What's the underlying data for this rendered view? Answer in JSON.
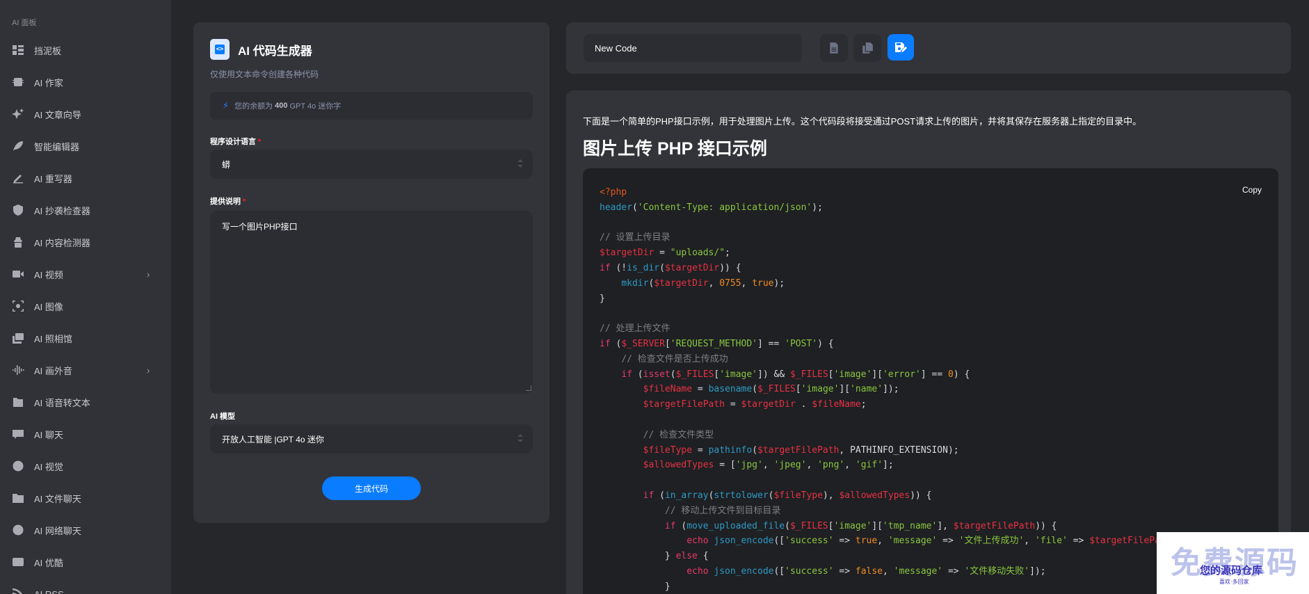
{
  "sidebar": {
    "section_label": "AI 面板",
    "items": [
      {
        "label": "挡泥板",
        "icon": "dashboard-icon",
        "has_submenu": false
      },
      {
        "label": "AI 作家",
        "icon": "ai-chip-icon",
        "has_submenu": false
      },
      {
        "label": "AI 文章向导",
        "icon": "sparkles-icon",
        "has_submenu": false
      },
      {
        "label": "智能编辑器",
        "icon": "feather-icon",
        "has_submenu": false
      },
      {
        "label": "AI 重写器",
        "icon": "pen-icon",
        "has_submenu": false
      },
      {
        "label": "AI 抄袭检查器",
        "icon": "shield-check-icon",
        "has_submenu": false
      },
      {
        "label": "AI 内容检测器",
        "icon": "detective-icon",
        "has_submenu": false
      },
      {
        "label": "AI 视频",
        "icon": "video-camera-icon",
        "has_submenu": true
      },
      {
        "label": "AI 图像",
        "icon": "image-scan-icon",
        "has_submenu": false
      },
      {
        "label": "AI 照相馆",
        "icon": "photo-gallery-icon",
        "has_submenu": false
      },
      {
        "label": "AI 画外音",
        "icon": "waveform-icon",
        "has_submenu": true
      },
      {
        "label": "AI 语音转文本",
        "icon": "audio-file-icon",
        "has_submenu": false
      },
      {
        "label": "AI 聊天",
        "icon": "chat-bubble-icon",
        "has_submenu": false
      },
      {
        "label": "AI 视觉",
        "icon": "brain-icon",
        "has_submenu": false
      },
      {
        "label": "AI 文件聊天",
        "icon": "folder-dots-icon",
        "has_submenu": false
      },
      {
        "label": "AI 网络聊天",
        "icon": "globe-icon",
        "has_submenu": false
      },
      {
        "label": "AI 优酷",
        "icon": "youtube-icon",
        "has_submenu": false
      },
      {
        "label": "AI RSS",
        "icon": "rss-icon",
        "has_submenu": false
      }
    ],
    "submenu_chevron": "›"
  },
  "generator": {
    "title": "AI 代码生成器",
    "subtitle": "仅使用文本命令创建各种代码",
    "balance_prefix": "您的余额为",
    "balance_amount": "400",
    "balance_suffix": "GPT 4o 迷你字",
    "language_label": "程序设计语言",
    "language_value": "蟒",
    "description_label": "提供说明",
    "description_value": "写一个图片PHP接口",
    "model_label": "AI 模型",
    "model_value": "开放人工智能 |GPT 4o 迷你",
    "required_mark": "*",
    "generate_button": "生成代码"
  },
  "document": {
    "name_value": "New Code",
    "toolbar": [
      "document-icon",
      "copy-icon",
      "save-icon"
    ]
  },
  "result": {
    "intro": "下面是一个简单的PHP接口示例，用于处理图片上传。这个代码段将接受通过POST请求上传的图片，并将其保存在服务器上指定的目录中。",
    "heading": "图片上传 PHP 接口示例",
    "copy_label": "Copy",
    "code_lines": [
      [
        [
          "tag",
          "<?php"
        ]
      ],
      [
        [
          "fn",
          "header"
        ],
        [
          "p",
          "("
        ],
        [
          "str",
          "'Content-Type: application/json'"
        ],
        [
          "p",
          ");"
        ]
      ],
      [],
      [
        [
          "com",
          "// 设置上传目录"
        ]
      ],
      [
        [
          "var",
          "$targetDir"
        ],
        [
          "p",
          " = "
        ],
        [
          "str",
          "\"uploads/\""
        ],
        [
          "p",
          ";"
        ]
      ],
      [
        [
          "kw",
          "if"
        ],
        [
          "p",
          " (!"
        ],
        [
          "fn",
          "is_dir"
        ],
        [
          "p",
          "("
        ],
        [
          "var",
          "$targetDir"
        ],
        [
          "p",
          ")) {"
        ]
      ],
      [
        [
          "p",
          "    "
        ],
        [
          "fn",
          "mkdir"
        ],
        [
          "p",
          "("
        ],
        [
          "var",
          "$targetDir"
        ],
        [
          "p",
          ", "
        ],
        [
          "num",
          "0755"
        ],
        [
          "p",
          ", "
        ],
        [
          "num",
          "true"
        ],
        [
          "p",
          ");"
        ]
      ],
      [
        [
          "p",
          "}"
        ]
      ],
      [],
      [
        [
          "com",
          "// 处理上传文件"
        ]
      ],
      [
        [
          "kw",
          "if"
        ],
        [
          "p",
          " ("
        ],
        [
          "var",
          "$_SERVER"
        ],
        [
          "p",
          "["
        ],
        [
          "str",
          "'REQUEST_METHOD'"
        ],
        [
          "p",
          "] == "
        ],
        [
          "str",
          "'POST'"
        ],
        [
          "p",
          ") {"
        ]
      ],
      [
        [
          "p",
          "    "
        ],
        [
          "com",
          "// 检查文件是否上传成功"
        ]
      ],
      [
        [
          "p",
          "    "
        ],
        [
          "kw",
          "if"
        ],
        [
          "p",
          " ("
        ],
        [
          "kw",
          "isset"
        ],
        [
          "p",
          "("
        ],
        [
          "var",
          "$_FILES"
        ],
        [
          "p",
          "["
        ],
        [
          "str",
          "'image'"
        ],
        [
          "p",
          "]) && "
        ],
        [
          "var",
          "$_FILES"
        ],
        [
          "p",
          "["
        ],
        [
          "str",
          "'image'"
        ],
        [
          "p",
          "]["
        ],
        [
          "str",
          "'error'"
        ],
        [
          "p",
          "] == "
        ],
        [
          "num",
          "0"
        ],
        [
          "p",
          ") {"
        ]
      ],
      [
        [
          "p",
          "        "
        ],
        [
          "var",
          "$fileName"
        ],
        [
          "p",
          " = "
        ],
        [
          "fn",
          "basename"
        ],
        [
          "p",
          "("
        ],
        [
          "var",
          "$_FILES"
        ],
        [
          "p",
          "["
        ],
        [
          "str",
          "'image'"
        ],
        [
          "p",
          "]["
        ],
        [
          "str",
          "'name'"
        ],
        [
          "p",
          "]);"
        ]
      ],
      [
        [
          "p",
          "        "
        ],
        [
          "var",
          "$targetFilePath"
        ],
        [
          "p",
          " = "
        ],
        [
          "var",
          "$targetDir"
        ],
        [
          "p",
          " . "
        ],
        [
          "var",
          "$fileName"
        ],
        [
          "p",
          ";"
        ]
      ],
      [],
      [
        [
          "p",
          "        "
        ],
        [
          "com",
          "// 检查文件类型"
        ]
      ],
      [
        [
          "p",
          "        "
        ],
        [
          "var",
          "$fileType"
        ],
        [
          "p",
          " = "
        ],
        [
          "fn",
          "pathinfo"
        ],
        [
          "p",
          "("
        ],
        [
          "var",
          "$targetFilePath"
        ],
        [
          "p",
          ", PATHINFO_EXTENSION);"
        ]
      ],
      [
        [
          "p",
          "        "
        ],
        [
          "var",
          "$allowedTypes"
        ],
        [
          "p",
          " = ["
        ],
        [
          "str",
          "'jpg'"
        ],
        [
          "p",
          ", "
        ],
        [
          "str",
          "'jpeg'"
        ],
        [
          "p",
          ", "
        ],
        [
          "str",
          "'png'"
        ],
        [
          "p",
          ", "
        ],
        [
          "str",
          "'gif'"
        ],
        [
          "p",
          "];"
        ]
      ],
      [],
      [
        [
          "p",
          "        "
        ],
        [
          "kw",
          "if"
        ],
        [
          "p",
          " ("
        ],
        [
          "fn",
          "in_array"
        ],
        [
          "p",
          "("
        ],
        [
          "fn",
          "strtolower"
        ],
        [
          "p",
          "("
        ],
        [
          "var",
          "$fileType"
        ],
        [
          "p",
          "), "
        ],
        [
          "var",
          "$allowedTypes"
        ],
        [
          "p",
          ")) {"
        ]
      ],
      [
        [
          "p",
          "            "
        ],
        [
          "com",
          "// 移动上传文件到目标目录"
        ]
      ],
      [
        [
          "p",
          "            "
        ],
        [
          "kw",
          "if"
        ],
        [
          "p",
          " ("
        ],
        [
          "fn",
          "move_uploaded_file"
        ],
        [
          "p",
          "("
        ],
        [
          "var",
          "$_FILES"
        ],
        [
          "p",
          "["
        ],
        [
          "str",
          "'image'"
        ],
        [
          "p",
          "]["
        ],
        [
          "str",
          "'tmp_name'"
        ],
        [
          "p",
          "], "
        ],
        [
          "var",
          "$targetFilePath"
        ],
        [
          "p",
          ")) {"
        ]
      ],
      [
        [
          "p",
          "                "
        ],
        [
          "kw",
          "echo"
        ],
        [
          "p",
          " "
        ],
        [
          "fn",
          "json_encode"
        ],
        [
          "p",
          "(["
        ],
        [
          "str",
          "'success'"
        ],
        [
          "p",
          " => "
        ],
        [
          "num",
          "true"
        ],
        [
          "p",
          ", "
        ],
        [
          "str",
          "'message'"
        ],
        [
          "p",
          " => "
        ],
        [
          "str",
          "'文件上传成功'"
        ],
        [
          "p",
          ", "
        ],
        [
          "str",
          "'file'"
        ],
        [
          "p",
          " => "
        ],
        [
          "var",
          "$targetFilePath"
        ],
        [
          "p",
          "]);"
        ]
      ],
      [
        [
          "p",
          "            } "
        ],
        [
          "kw",
          "else"
        ],
        [
          "p",
          " {"
        ]
      ],
      [
        [
          "p",
          "                "
        ],
        [
          "kw",
          "echo"
        ],
        [
          "p",
          " "
        ],
        [
          "fn",
          "json_encode"
        ],
        [
          "p",
          "(["
        ],
        [
          "str",
          "'success'"
        ],
        [
          "p",
          " => "
        ],
        [
          "num",
          "false"
        ],
        [
          "p",
          ", "
        ],
        [
          "str",
          "'message'"
        ],
        [
          "p",
          " => "
        ],
        [
          "str",
          "'文件移动失败'"
        ],
        [
          "p",
          "]);"
        ]
      ],
      [
        [
          "p",
          "            }"
        ]
      ]
    ]
  },
  "watermark": {
    "big": "免费源码",
    "mid": "您的源码仓库",
    "small": "喜欢·多回家"
  }
}
